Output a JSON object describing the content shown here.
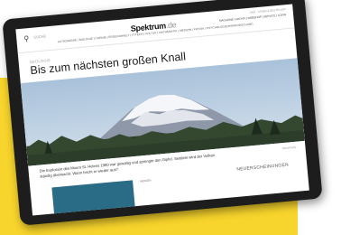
{
  "header": {
    "search_label": "SUCHE",
    "logo_main": "Spektrum",
    "logo_tld": ".de",
    "subscribe_label": "ABO · LESEN & BESTELLEN",
    "links": "MAGAZINE | ARCHIV | WEBSHOP | SERVICE | LOGIN"
  },
  "categories": "ASTRONOMIE | BIOLOGIE | CHEMIE | ERDE/UMWELT | IT/TECH | KULTUR | MATHEMATIK | MEDIZIN | PHYSIK | PSYCHOLOGIE/HIRNFORSCHUNG",
  "article": {
    "kicker": "GEOLOGIE",
    "headline": "Bis zum nächsten großen Knall",
    "caption": "Die Explosion des Mount St. Helens 1980 war gewaltig und sprengte den Gipfel. Seitdem wird der Vulkan ständig überwacht. Wann bricht er wieder aus?",
    "credit": "Stone/Getty"
  },
  "sidebar": {
    "heading": "NEUERSCHEINUNGEN",
    "teaser_label": "MEDIZIN"
  },
  "colors": {
    "background_accent": "#f8d52c",
    "tablet_frame": "#1d1d1d"
  }
}
